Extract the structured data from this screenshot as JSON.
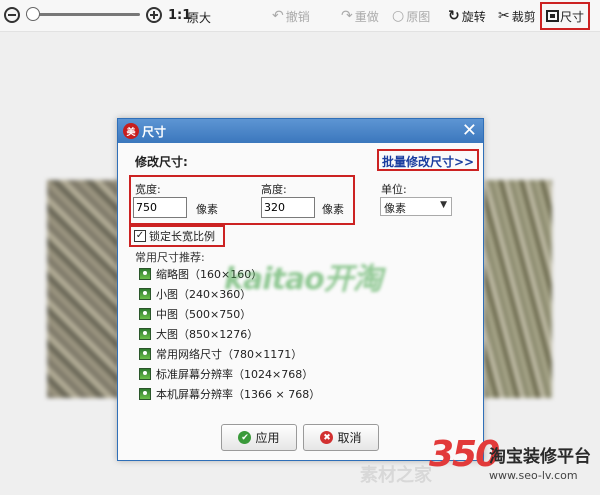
{
  "toolbar": {
    "zoom_ratio": "1:1",
    "original_size": "原大",
    "undo": "撤销",
    "redo": "重做",
    "original_image": "原图",
    "rotate": "旋转",
    "crop": "裁剪",
    "size": "尺寸"
  },
  "dialog": {
    "title": "尺寸",
    "logo_text": "美",
    "section_title": "修改尺寸:",
    "batch_link": "批量修改尺寸>>",
    "width_label": "宽度:",
    "width_value": "750",
    "width_unit": "像素",
    "height_label": "高度:",
    "height_value": "320",
    "height_unit": "像素",
    "unit_label": "单位:",
    "unit_value": "像素",
    "lock_ratio_label": "锁定长宽比例",
    "lock_ratio_checked": true,
    "recommend_title": "常用尺寸推荐:",
    "recommendations": [
      "缩略图（160×160）",
      "小图（240×360）",
      "中图（500×750）",
      "大图（850×1276）",
      "常用网络尺寸（780×1171）",
      "标准屏幕分辨率（1024×768）",
      "本机屏幕分辨率（1366 × 768）"
    ],
    "ok_button": "应用",
    "cancel_button": "取消"
  },
  "watermark_text": "kaitao开淘",
  "site": {
    "number": "350",
    "name": "淘宝装修平台",
    "url": "www.seo-lv.com",
    "faint_text": "素材之家"
  },
  "colors": {
    "highlight_red": "#cc2222",
    "dialog_title_blue": "#3b77bd",
    "link_blue": "#1a3da0"
  }
}
